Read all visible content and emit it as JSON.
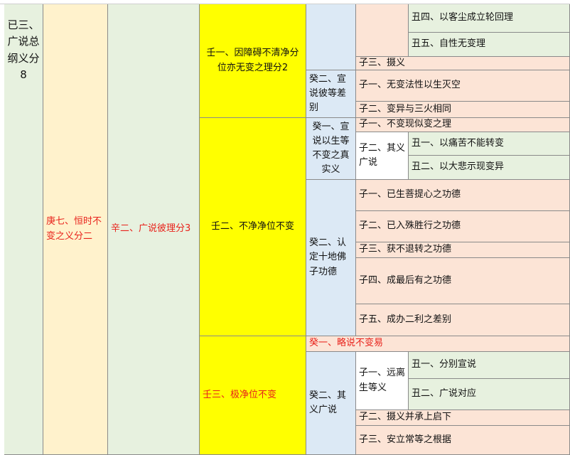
{
  "col1": "已三、广说总纲义分8",
  "col2": "庚七、恒时不变之义分二",
  "col3": "辛二、广说彼理分3",
  "ren": [
    "壬一、因障碍不清净分位亦无变之理分2",
    "壬二、不净净位不变",
    "壬三、极净位不变"
  ],
  "gui": [
    "癸二、宣说彼等差别",
    "癸一、宣说以生等不变之真实义",
    "癸二、认定十地佛子功德",
    "癸一、略说不变易",
    "癸二、其义广说"
  ],
  "zi": [
    "子三、摄义",
    "子一、无变法性以生灭空",
    "子二、变异与三火相同",
    "子一、不变现似变之理",
    "子二、其义广说",
    "子一、已生菩提心之功德",
    "子二、已入殊胜行之功德",
    "子三、获不退转之功德",
    "子四、成最后有之功德",
    "子五、成办二利之差别",
    "子一、远离生等义",
    "子二、摄义并承上启下",
    "子三、安立常等之根据"
  ],
  "chou": [
    "丑四、以客尘成立轮回理",
    "丑五、自性无变理",
    "丑一、以痛苦不能转变",
    "丑二、以大悲示现变异",
    "丑一、分别宣说",
    "丑二、广说对应"
  ],
  "colors": {
    "green": "#e7f1df",
    "cream": "#fff2cc",
    "yellow": "#ffff00",
    "blue": "#dce9f5",
    "peach": "#fce4d6",
    "red": "#e8221b"
  }
}
